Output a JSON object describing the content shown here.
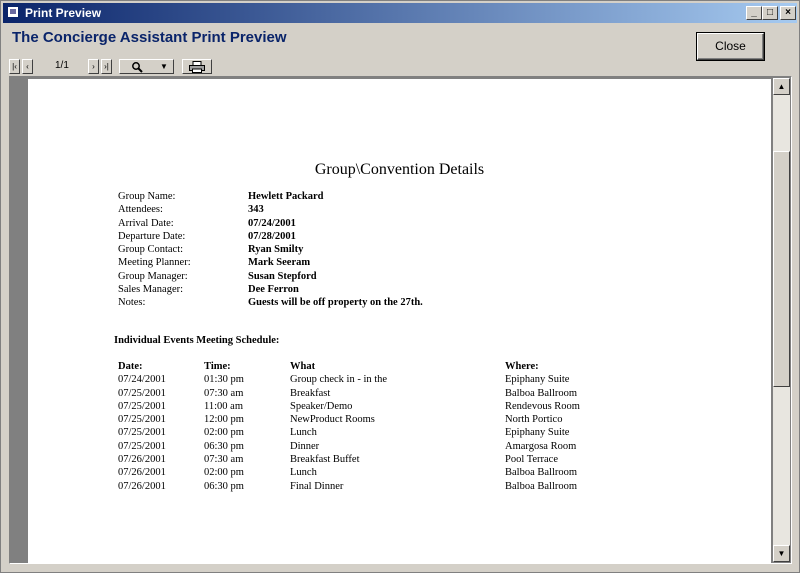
{
  "window": {
    "title": "Print Preview",
    "heading": "The Concierge Assistant Print Preview"
  },
  "toolbar": {
    "page": "1/1",
    "close_label": "Close",
    "first_symbol": "|‹",
    "prev_symbol": "‹",
    "next_symbol": "›",
    "last_symbol": "›|"
  },
  "report": {
    "title": "Group\\Convention Details",
    "fields": [
      {
        "label": "Group Name:",
        "value": "Hewlett Packard"
      },
      {
        "label": "Attendees:",
        "value": "343"
      },
      {
        "label": "Arrival Date:",
        "value": "07/24/2001"
      },
      {
        "label": "Departure Date:",
        "value": "07/28/2001"
      },
      {
        "label": "Group Contact:",
        "value": "Ryan Smilty"
      },
      {
        "label": "Meeting Planner:",
        "value": "Mark Seeram"
      },
      {
        "label": "Group Manager:",
        "value": "Susan Stepford"
      },
      {
        "label": "Sales Manager:",
        "value": "Dee Ferron"
      },
      {
        "label": "Notes:",
        "value": "Guests will be off property on the 27th."
      }
    ],
    "schedule_heading": "Individual Events Meeting Schedule:",
    "columns": [
      "Date:",
      "Time:",
      "What",
      "Where:"
    ],
    "rows": [
      [
        "07/24/2001",
        "01:30 pm",
        "Group check in - in the",
        "Epiphany Suite"
      ],
      [
        "07/25/2001",
        "07:30 am",
        "Breakfast",
        "Balboa Ballroom"
      ],
      [
        "07/25/2001",
        "11:00 am",
        "Speaker/Demo",
        "Rendevous Room"
      ],
      [
        "07/25/2001",
        "12:00 pm",
        "NewProduct Rooms",
        "North Portico"
      ],
      [
        "07/25/2001",
        "02:00 pm",
        "Lunch",
        "Epiphany Suite"
      ],
      [
        "07/25/2001",
        "06:30 pm",
        "Dinner",
        "Amargosa Room"
      ],
      [
        "07/26/2001",
        "07:30 am",
        "Breakfast Buffet",
        "Pool Terrace"
      ],
      [
        "07/26/2001",
        "02:00 pm",
        "Lunch",
        "Balboa Ballroom"
      ],
      [
        "07/26/2001",
        "06:30 pm",
        "Final Dinner",
        "Balboa Ballroom"
      ]
    ]
  }
}
